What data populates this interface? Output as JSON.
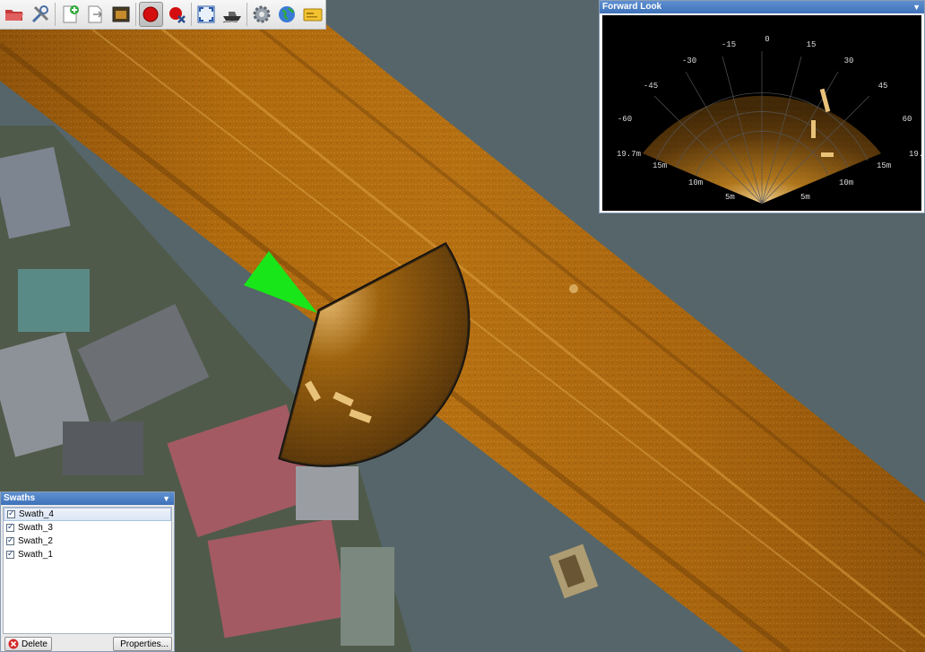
{
  "toolbar": {
    "buttons": [
      {
        "icon": "open-folder-icon"
      },
      {
        "icon": "tools-icon"
      },
      {
        "icon": "new-document-icon"
      },
      {
        "icon": "export-document-icon"
      },
      {
        "icon": "image-map-icon"
      },
      {
        "icon": "record-icon",
        "active": true
      },
      {
        "icon": "stop-record-icon"
      },
      {
        "icon": "fullscreen-icon"
      },
      {
        "icon": "boat-icon"
      },
      {
        "icon": "settings-gear-icon"
      },
      {
        "icon": "globe-icon"
      },
      {
        "icon": "id-card-icon"
      }
    ]
  },
  "forward_look": {
    "title": "Forward Look",
    "angle_labels": [
      "-60",
      "-45",
      "-30",
      "-15",
      "0",
      "15",
      "30",
      "45",
      "60"
    ],
    "range_labels_left": [
      "19.7m",
      "15m",
      "10m",
      "5m"
    ],
    "range_labels_right": [
      "19.",
      "15m",
      "10m",
      "5m"
    ]
  },
  "swaths": {
    "title": "Swaths",
    "items": [
      {
        "label": "Swath_4",
        "checked": true,
        "selected": true
      },
      {
        "label": "Swath_3",
        "checked": true,
        "selected": false
      },
      {
        "label": "Swath_2",
        "checked": true,
        "selected": false
      },
      {
        "label": "Swath_1",
        "checked": true,
        "selected": false
      }
    ],
    "delete_label": "Delete",
    "properties_label": "Properties..."
  },
  "colors": {
    "sonar_gold": "#b8700f",
    "water": "#536369",
    "cursor_green": "#19e619",
    "panel_header": "#3f72b9"
  }
}
